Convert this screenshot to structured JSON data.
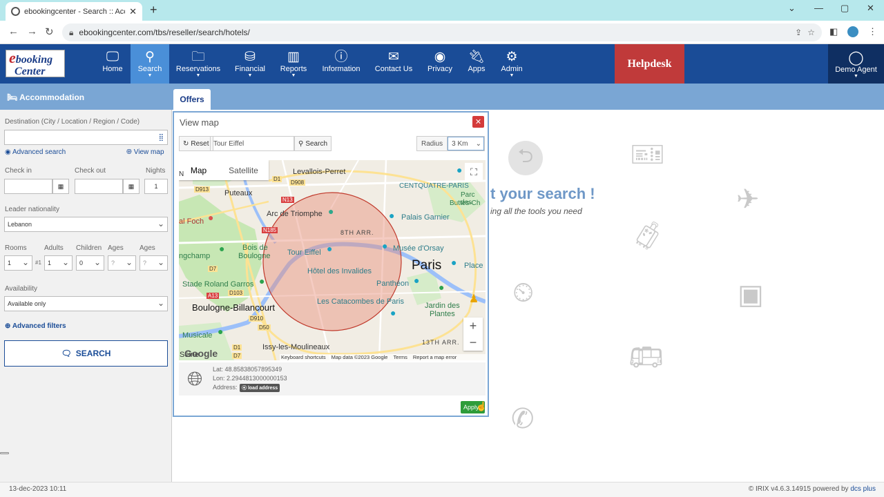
{
  "browser": {
    "tab_title": "ebookingcenter - Search :: Acco",
    "url": "ebookingcenter.com/tbs/reseller/search/hotels/"
  },
  "header": {
    "logo_line1": "booking",
    "logo_line2": "Center",
    "nav": [
      {
        "label": "Home",
        "icon": "monitor-icon"
      },
      {
        "label": "Search",
        "icon": "search-icon"
      },
      {
        "label": "Reservations",
        "icon": "folder-icon"
      },
      {
        "label": "Financial",
        "icon": "coins-icon"
      },
      {
        "label": "Reports",
        "icon": "building-chart-icon"
      },
      {
        "label": "Information",
        "icon": "info-icon"
      },
      {
        "label": "Contact Us",
        "icon": "envelope-icon"
      },
      {
        "label": "Privacy",
        "icon": "eye-slash-icon"
      },
      {
        "label": "Apps",
        "icon": "plug-icon"
      },
      {
        "label": "Admin",
        "icon": "gear-icon"
      }
    ],
    "helpdesk": "Helpdesk",
    "agent": "Demo Agent"
  },
  "subbar": {
    "section": "Accommodation",
    "tab": "Offers"
  },
  "sidebar": {
    "destination_label": "Destination (City / Location / Region / Code)",
    "destination_value": "",
    "advanced_search": "Advanced search",
    "view_map": "View map",
    "checkin_label": "Check in",
    "checkout_label": "Check out",
    "nights_label": "Nights",
    "nights_value": "1",
    "nationality_label": "Leader nationality",
    "nationality_value": "Lebanon",
    "rooms_label": "Rooms",
    "adults_label": "Adults",
    "children_label": "Children",
    "ages_label": "Ages",
    "rooms_value": "1",
    "room_index": "#1",
    "adults_value": "1",
    "children_value": "0",
    "age1_value": "?",
    "age2_value": "?",
    "availability_label": "Availability",
    "availability_value": "Available only",
    "advanced_filters": "Advanced filters",
    "search_button": "SEARCH"
  },
  "modal": {
    "title": "View map",
    "reset": "Reset",
    "search_value": "Tour Eiffel",
    "search_button": "Search",
    "radius_label": "Radius",
    "radius_value": "3 Km",
    "map_type": "Map",
    "satellite": "Satellite",
    "map_labels": {
      "levallois": "Levallois-Perret",
      "centquatre": "CENTQUATRE-PARIS",
      "puteaux": "Puteaux",
      "parc": "Parc des",
      "buttes": "Buttes-Ch",
      "arc": "Arc de Triomphe",
      "palais": "Palais Garnier",
      "foch": "al Foch",
      "arr8": "8TH ARR.",
      "bois": "Bois de",
      "boulogne": "Boulogne",
      "gchamp": "ngchamp",
      "tour": "Tour Eiffel",
      "orsay": "Musée d'Orsay",
      "paris": "Paris",
      "invalides": "Hôtel des Invalides",
      "place": "Place",
      "stade": "Stade Roland Garros",
      "pantheon": "Panthéon",
      "boulogne_b": "Boulogne-Billancourt",
      "catacombes": "Les Catacombes de Paris",
      "jardin": "Jardin des",
      "plantes": "Plantes",
      "musicale": "Musicale",
      "issy": "Issy-les-Moulineaux",
      "arr13": "13TH ARR.",
      "seine": "Seine",
      "google": "Google",
      "shortcuts": "Keyboard shortcuts",
      "mapdata": "Map data ©2023 Google",
      "terms": "Terms",
      "report": "Report a map error",
      "n": "N",
      "d913": "D913",
      "d1": "D1",
      "d908": "D908",
      "n13": "N13",
      "n185": "N185",
      "d7": "D7",
      "a13": "A13",
      "d103": "D103",
      "d910": "D910",
      "d50": "D50",
      "d1b": "D1",
      "d7b": "D7"
    },
    "lat": "Lat: 48.858380578953​49",
    "lon": "Lon: 2.2944813000000153",
    "address_label": "Address:",
    "load_address": "load address",
    "apply": "Apply"
  },
  "hero": {
    "title": "t your search !",
    "subtitle": "ing all the tools you need"
  },
  "footer": {
    "datetime": "13-dec-2023 10:11",
    "version_prefix": "© IRIX v4.6.3.14915 powered by ",
    "vendor": "dcs plus"
  },
  "colors": {
    "header_bg": "#1a4c97",
    "active_nav": "#4a8fd8",
    "subbar": "#7aa6d4",
    "helpdesk": "#c03a3a",
    "radius_fill": "#e88d7b",
    "apply": "#2e9c3a"
  }
}
